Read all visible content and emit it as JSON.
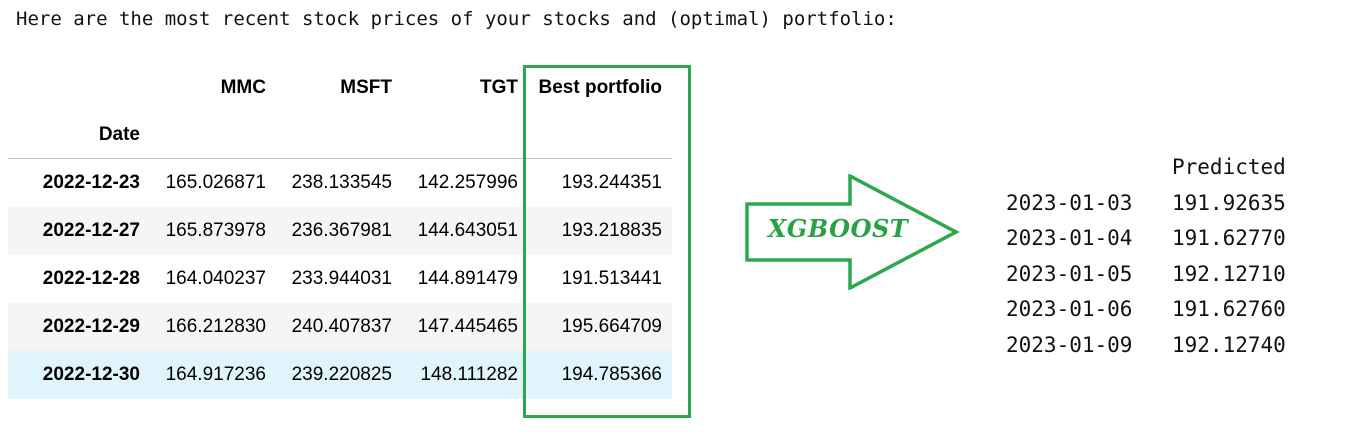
{
  "intro_text": "Here are the most recent stock prices of your stocks and (optimal) portfolio:",
  "table": {
    "columns": [
      "MMC",
      "MSFT",
      "TGT",
      "Best portfolio"
    ],
    "index_name": "Date",
    "rows": [
      {
        "date": "2022-12-23",
        "values": [
          "165.026871",
          "238.133545",
          "142.257996",
          "193.244351"
        ]
      },
      {
        "date": "2022-12-27",
        "values": [
          "165.873978",
          "236.367981",
          "144.643051",
          "193.218835"
        ]
      },
      {
        "date": "2022-12-28",
        "values": [
          "164.040237",
          "233.944031",
          "144.891479",
          "191.513441"
        ]
      },
      {
        "date": "2022-12-29",
        "values": [
          "166.212830",
          "240.407837",
          "147.445465",
          "195.664709"
        ]
      },
      {
        "date": "2022-12-30",
        "values": [
          "164.917236",
          "239.220825",
          "148.111282",
          "194.785366"
        ]
      }
    ]
  },
  "arrow_label": "XGBOOST",
  "prediction": {
    "header": "Predicted",
    "rows": [
      {
        "date": "2023-01-03",
        "value": "191.92635"
      },
      {
        "date": "2023-01-04",
        "value": "191.62770"
      },
      {
        "date": "2023-01-05",
        "value": "192.12710"
      },
      {
        "date": "2023-01-06",
        "value": "191.62760"
      },
      {
        "date": "2023-01-09",
        "value": "192.12740"
      }
    ]
  },
  "colors": {
    "accent_green": "#2aa84a",
    "hover_row": "#e0f4fb",
    "stripe_row": "#f5f5f5"
  }
}
